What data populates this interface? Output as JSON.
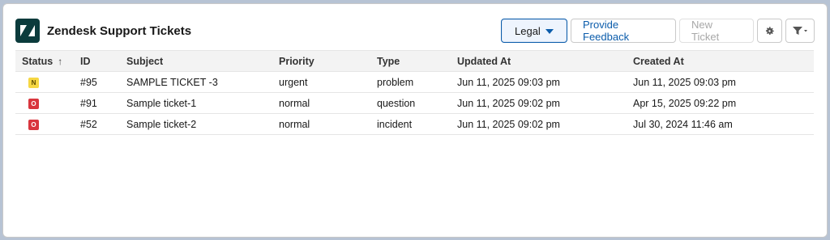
{
  "header": {
    "title": "Zendesk Support Tickets",
    "logo_icon": "zendesk-logo-icon",
    "view_selector": "Legal",
    "feedback_label": "Provide Feedback",
    "new_ticket_label": "New Ticket",
    "settings_icon": "gear-icon",
    "filter_icon": "filter-icon"
  },
  "table": {
    "columns": [
      "Status",
      "ID",
      "Subject",
      "Priority",
      "Type",
      "Updated At",
      "Created At"
    ],
    "sort_indicator": "↑",
    "rows": [
      {
        "status": "N",
        "status_color": "#f6d743",
        "status_text_color": "#5c4a00",
        "id": "#95",
        "subject": "SAMPLE TICKET -3",
        "priority": "urgent",
        "type": "problem",
        "updated": "Jun 11, 2025 09:03 pm",
        "created": "Jun 11, 2025 09:03 pm"
      },
      {
        "status": "O",
        "status_color": "#d9363e",
        "status_text_color": "#ffffff",
        "id": "#91",
        "subject": "Sample ticket-1",
        "priority": "normal",
        "type": "question",
        "updated": "Jun 11, 2025 09:02 pm",
        "created": "Apr 15, 2025 09:22 pm"
      },
      {
        "status": "O",
        "status_color": "#d9363e",
        "status_text_color": "#ffffff",
        "id": "#52",
        "subject": "Sample ticket-2",
        "priority": "normal",
        "type": "incident",
        "updated": "Jun 11, 2025 09:02 pm",
        "created": "Jul 30, 2024 11:46 am"
      }
    ]
  },
  "colors": {
    "brand": "#0b3b3c",
    "accent": "#0b5cab"
  }
}
